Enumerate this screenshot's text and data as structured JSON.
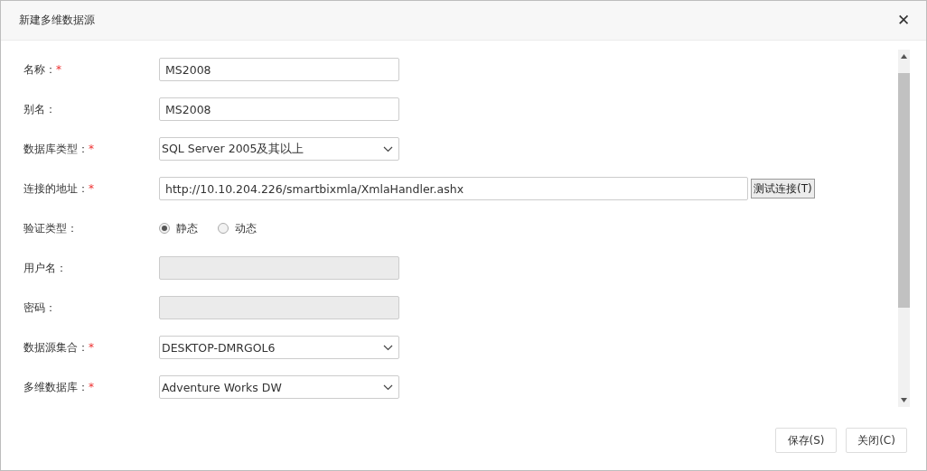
{
  "dialog": {
    "title": "新建多维数据源",
    "close": "✕"
  },
  "fields": [
    {
      "kind": "text",
      "label": "名称：",
      "required": true,
      "value": "MS2008"
    },
    {
      "kind": "text",
      "label": "别名：",
      "required": false,
      "value": "MS2008"
    },
    {
      "kind": "select",
      "label": "数据库类型：",
      "required": true,
      "value": "SQL Server 2005及其以上"
    },
    {
      "kind": "url",
      "label": "连接的地址：",
      "required": true,
      "value": "http://10.10.204.226/smartbixmla/XmlaHandler.ashx",
      "button": "测试连接(T)"
    },
    {
      "kind": "radio",
      "label": "验证类型：",
      "required": false,
      "options": [
        {
          "label": "静态",
          "selected": true
        },
        {
          "label": "动态",
          "selected": false
        }
      ]
    },
    {
      "kind": "disabled",
      "label": "用户名：",
      "required": false
    },
    {
      "kind": "disabled",
      "label": "密码：",
      "required": false
    },
    {
      "kind": "select",
      "label": "数据源集合：",
      "required": true,
      "value": "DESKTOP-DMRGOL6"
    },
    {
      "kind": "select",
      "label": "多维数据库：",
      "required": true,
      "value": "Adventure Works DW"
    }
  ],
  "required_mark": "*",
  "buttons": [
    "保存(S)",
    "关闭(C)"
  ]
}
